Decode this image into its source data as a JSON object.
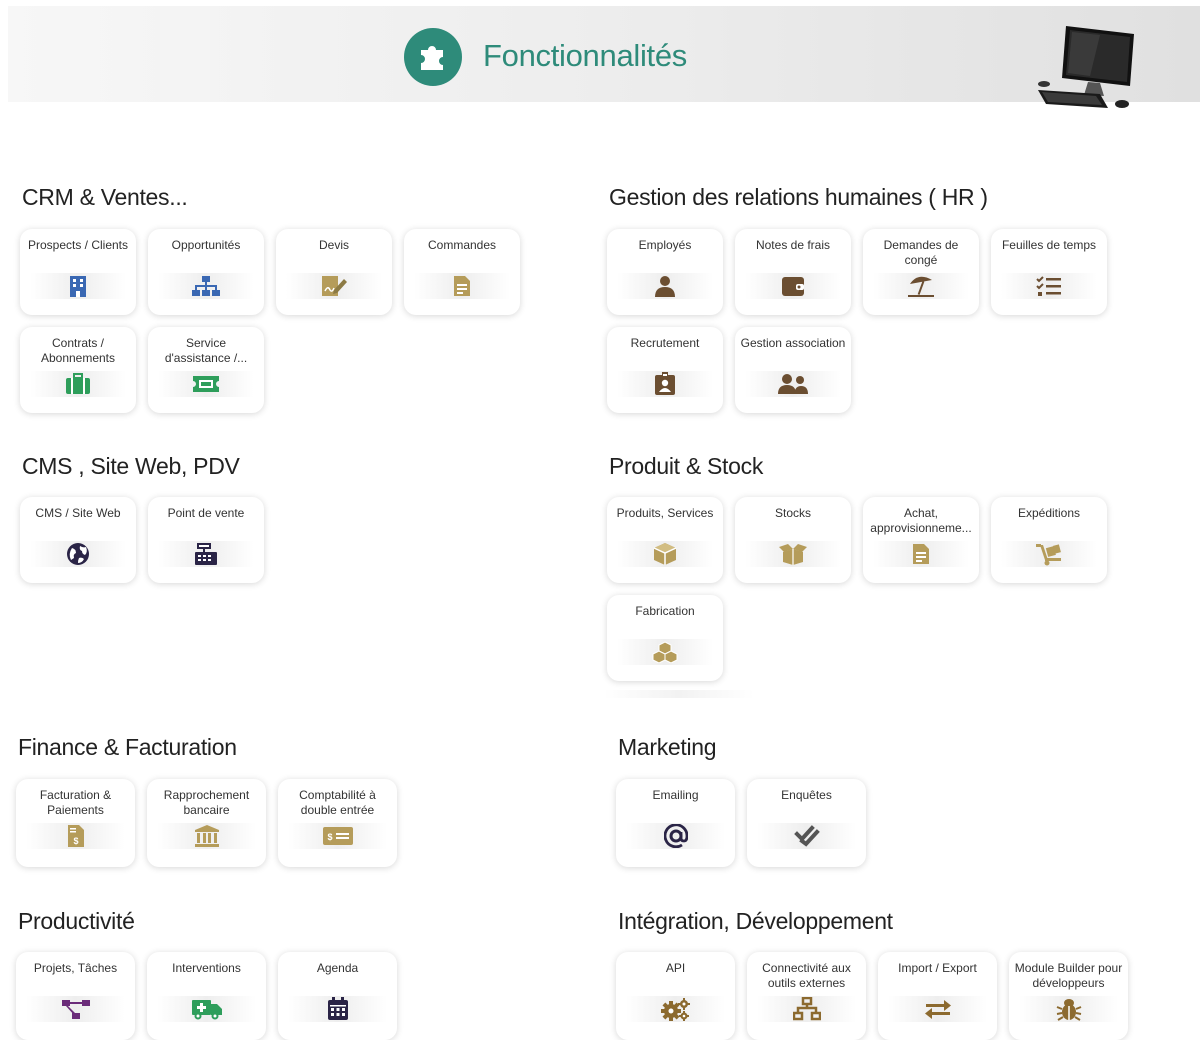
{
  "header": {
    "title": "Fonctionnalités"
  },
  "colors": {
    "teal": "#2e8b7a",
    "blue": "#3a68b3",
    "purple": "#6b2c7a",
    "olive": "#b59c5a",
    "brown": "#6b4e31",
    "green": "#2e9e5b",
    "navy": "#2a2446"
  },
  "sections": {
    "crm": {
      "title": "CRM & Ventes...",
      "tiles": [
        {
          "label": "Prospects / Clients",
          "icon": "building-icon"
        },
        {
          "label": "Opportunités",
          "icon": "org-chart-icon"
        },
        {
          "label": "Devis",
          "icon": "signed-doc-icon"
        },
        {
          "label": "Commandes",
          "icon": "order-doc-icon"
        },
        {
          "label": "Contrats / Abonnements",
          "icon": "briefcase-icon"
        },
        {
          "label": "Service d'assistance /...",
          "icon": "ticket-icon"
        }
      ]
    },
    "hr": {
      "title": "Gestion des relations humaines ( HR )",
      "tiles": [
        {
          "label": "Employés",
          "icon": "user-icon"
        },
        {
          "label": "Notes de frais",
          "icon": "wallet-icon"
        },
        {
          "label": "Demandes de congé",
          "icon": "beach-umbrella-icon"
        },
        {
          "label": "Feuilles de temps",
          "icon": "checklist-icon"
        },
        {
          "label": "Recrutement",
          "icon": "id-badge-icon"
        },
        {
          "label": "Gestion association",
          "icon": "users-icon"
        }
      ]
    },
    "cms": {
      "title": "CMS , Site Web, PDV",
      "tiles": [
        {
          "label": "CMS / Site Web",
          "icon": "globe-icon"
        },
        {
          "label": "Point de vente",
          "icon": "cash-register-icon"
        }
      ]
    },
    "product": {
      "title": "Produit & Stock",
      "tiles": [
        {
          "label": "Produits, Services",
          "icon": "cube-icon"
        },
        {
          "label": "Stocks",
          "icon": "open-box-icon"
        },
        {
          "label": "Achat, approvisionneme...",
          "icon": "purchase-doc-icon"
        },
        {
          "label": "Expéditions",
          "icon": "dolly-icon"
        },
        {
          "label": "Fabrication",
          "icon": "cubes-icon"
        }
      ]
    },
    "finance": {
      "title": "Finance & Facturation",
      "tiles": [
        {
          "label": "Facturation & Paiements",
          "icon": "invoice-icon"
        },
        {
          "label": "Rapprochement bancaire",
          "icon": "bank-icon"
        },
        {
          "label": "Comptabilité à double entrée",
          "icon": "money-check-icon"
        }
      ]
    },
    "marketing": {
      "title": "Marketing",
      "tiles": [
        {
          "label": "Emailing",
          "icon": "at-icon"
        },
        {
          "label": "Enquêtes",
          "icon": "double-check-icon"
        }
      ]
    },
    "productivity": {
      "title": "Productivité",
      "tiles": [
        {
          "label": "Projets, Tâches",
          "icon": "project-diagram-icon"
        },
        {
          "label": "Interventions",
          "icon": "ambulance-icon"
        },
        {
          "label": "Agenda",
          "icon": "calendar-icon"
        }
      ]
    },
    "integration": {
      "title": "Intégration, Développement",
      "tiles": [
        {
          "label": "API",
          "icon": "cogs-icon"
        },
        {
          "label": "Connectivité aux outils externes",
          "icon": "network-icon"
        },
        {
          "label": "Import / Export",
          "icon": "exchange-icon"
        },
        {
          "label": "Module Builder pour développeurs",
          "icon": "bug-icon"
        }
      ]
    }
  }
}
